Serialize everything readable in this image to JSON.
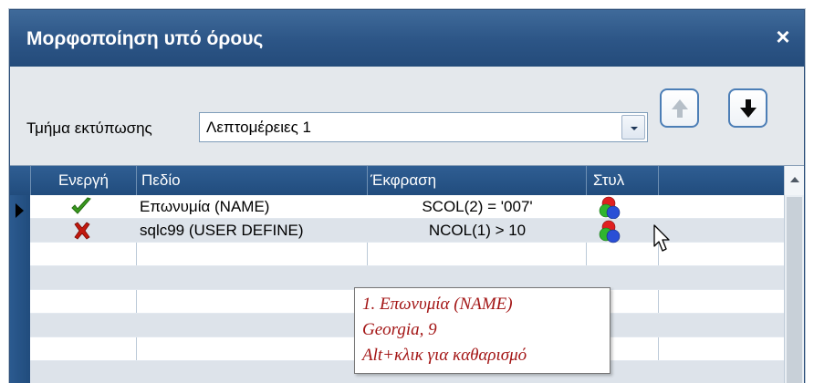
{
  "window": {
    "title": "Μορφοποίηση υπό όρους",
    "close_label": "×"
  },
  "toolbar": {
    "section_label": "Τμήμα εκτύπωσης",
    "section_value": "Λεπτομέρειες 1",
    "up_icon": "arrow-up-icon",
    "down_icon": "arrow-down-icon"
  },
  "grid": {
    "columns": [
      "Ενεργή",
      "Πεδίο",
      "Έκφραση",
      "Στυλ"
    ],
    "rows": [
      {
        "active": true,
        "active_icon": "check-icon",
        "field": "Επωνυμία (NAME)",
        "expression": "SCOL(2) = '007'",
        "style_icon": "style-circles-icon"
      },
      {
        "active": false,
        "active_icon": "cross-icon",
        "field": "sqlc99 (USER DEFINE)",
        "expression": "NCOL(1) > 10",
        "style_icon": "style-circles-icon"
      }
    ]
  },
  "tooltip": {
    "line1": "1. Επωνυμία (NAME)",
    "line2": "Georgia, 9",
    "line3": "Alt+κλικ για καθαρισμό"
  },
  "colors": {
    "title_bar": "#2c5586",
    "grid_header": "#2a578b",
    "tooltip_text": "#a31515",
    "check": "#3a9a1e",
    "cross": "#c2190f"
  }
}
